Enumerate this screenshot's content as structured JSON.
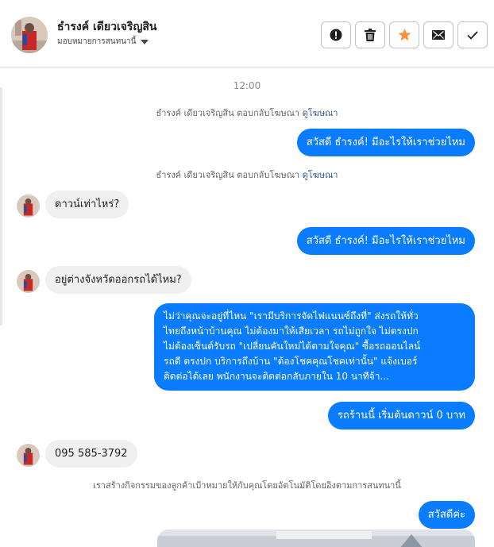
{
  "header": {
    "name": "ธำรงค์ เดียวเจริญสิน",
    "assign_label": "มอบหมายการสนทนานี้"
  },
  "toolbar": {
    "icons": [
      "alert-icon",
      "trash-icon",
      "star-icon",
      "envelope-icon",
      "check-icon"
    ],
    "star_color": "#f7923a"
  },
  "colors": {
    "outgoing": "#0a7cff",
    "incoming": "#f0f0f0",
    "link": "#385898"
  },
  "thread": {
    "timestamp": "12:00",
    "sys1_text": "ธำรงค์ เดียวเจริญสิน ตอบกลับโฆษณา",
    "sys1_link": "ดูโฆษณา",
    "msg1": "สวัสดี ธำรงค์! มีอะไรให้เราช่วยไหม",
    "sys2_text": "ธำรงค์ เดียวเจริญสิน ตอบกลับโฆษณา",
    "sys2_link": "ดูโฆษณา",
    "msg2": "ดาวน์เท่าไหร่?",
    "msg3": "สวัสดี ธำรงค์! มีอะไรให้เราช่วยไหม",
    "msg4": "อยู่ต่างจังหวัดออกรถได้ไหม?",
    "msg5_lines": [
      "ไม่ว่าคุณจะอยู่ที่ไหน \"เรามีบริการจัดไฟแนนซ์ถึงที่\"  ส่งรถให้ทั่ว",
      "ไทยถึงหน้าบ้านคุณ ไม่ต้องมาให้เสียเวลา รถไม่ถูกใจ ไม่ตรงปก",
      "ไม่ต้องเซ็นต์รับรถ \"เปลี่ยนคันใหม่ได้ตามใจคุณ\" ซื้อรถออนไลน์",
      "รถดี ตรงปก บริการถึงบ้าน \"ต้องโชคคุณโชคเท่านั้น\" แจ้งเบอร์",
      "ติดต่อได้เลย พนักงานจะติดต่อกลับภายใน 10 นาทีจ้า..."
    ],
    "msg6": "รถร้านนี้ เริ่มต้นดาวน์ 0 บาท",
    "msg7": "095 585-3792",
    "sys3_text": "เราสร้างกิจกรรมของลูกค้าเป้าหมายให้กับคุณโดยอัตโนมัติโดยอิงตามการสนทนานี้",
    "msg8": "สวัสดีค่ะ"
  }
}
